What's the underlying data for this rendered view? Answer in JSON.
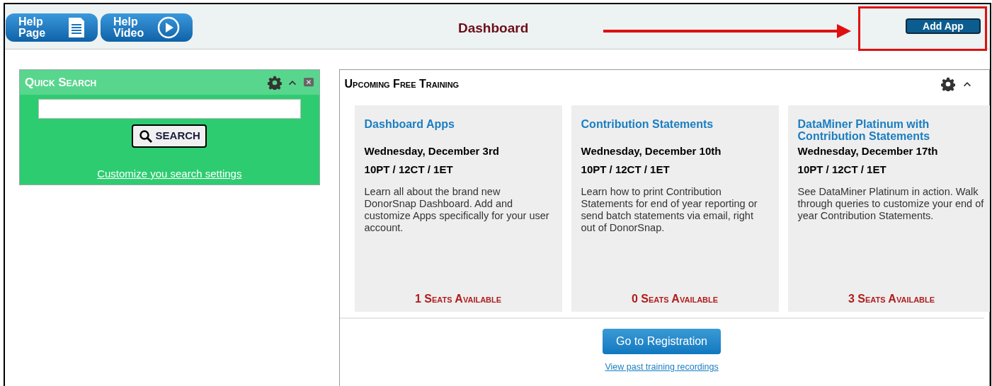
{
  "header": {
    "help_buttons": [
      {
        "kind": "page",
        "line1": "Help",
        "line2": "Page"
      },
      {
        "kind": "video",
        "line1": "Help",
        "line2": "Video"
      }
    ],
    "title": "Dashboard",
    "add_app": "Add App",
    "highlighted": true
  },
  "quick_search": {
    "title": "Quick Search",
    "button": "SEARCH",
    "link": "Customize you search settings"
  },
  "training": {
    "title": "Upcoming Free Training",
    "cards": [
      {
        "title": "Dashboard Apps",
        "date": "Wednesday, December 3rd",
        "time": "10PT / 12CT / 1ET",
        "description": "Learn all about the brand new DonorSnap Dashboard. Add and customize Apps specifically for your user account.",
        "seats": "1 Seats Available"
      },
      {
        "title": "Contribution Statements",
        "date": "Wednesday, December 10th",
        "time": "10PT / 12CT / 1ET",
        "description": "Learn how to print Contribution Statements for end of year reporting or send batch statements via email, right out of DonorSnap.",
        "seats": "0 Seats Available"
      },
      {
        "title": "DataMiner Platinum with Contribution Statements",
        "date": "Wednesday, December 17th",
        "time": "10PT / 12CT / 1ET",
        "description": "See DataMiner Platinum in action. Walk through queries to customize your end of year Contribution Statements.",
        "seats": "3 Seats Available"
      }
    ],
    "register_button": "Go to Registration",
    "link": "View past training recordings"
  }
}
